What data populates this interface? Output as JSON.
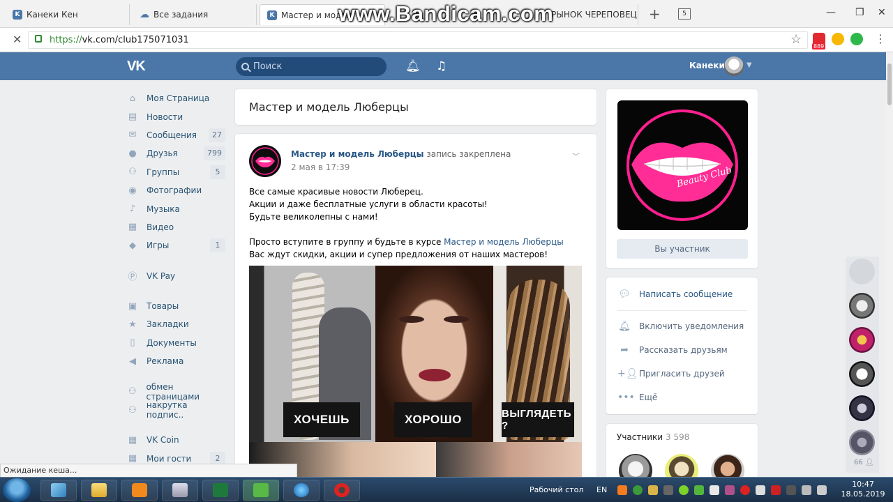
{
  "browser": {
    "tabs": [
      {
        "label": "Канеки Кен",
        "active": false
      },
      {
        "label": "Все задания",
        "active": false
      },
      {
        "label": "Мастер и модел",
        "active": true
      },
      {
        "label": "РЫНОК ЧЕРЕПОВЕЦ",
        "active": false
      }
    ],
    "tab_count": "5",
    "url_scheme": "https://",
    "url_rest": "vk.com/club175071031",
    "extension_badge": "889",
    "watermark": "www.Bandicam.com",
    "status_text": "Ожидание кеша..."
  },
  "header": {
    "logo": "VK",
    "search_placeholder": "Поиск",
    "user_name": "Канеки"
  },
  "nav": [
    {
      "label": "Моя Страница",
      "icon": "home-icon",
      "glyph": "⌂",
      "count": ""
    },
    {
      "label": "Новости",
      "icon": "news-icon",
      "glyph": "▤",
      "count": ""
    },
    {
      "label": "Сообщения",
      "icon": "messages-icon",
      "glyph": "✉",
      "count": "27"
    },
    {
      "label": "Друзья",
      "icon": "friends-icon",
      "glyph": "●",
      "count": "799"
    },
    {
      "label": "Группы",
      "icon": "groups-icon",
      "glyph": "⚇",
      "count": "5"
    },
    {
      "label": "Фотографии",
      "icon": "camera-icon",
      "glyph": "◉",
      "count": ""
    },
    {
      "label": "Музыка",
      "icon": "music-icon",
      "glyph": "♪",
      "count": ""
    },
    {
      "label": "Видео",
      "icon": "video-icon",
      "glyph": "▦",
      "count": ""
    },
    {
      "label": "Игры",
      "icon": "games-icon",
      "glyph": "◆",
      "count": "1"
    },
    {
      "sep": true
    },
    {
      "label": "VK Pay",
      "icon": "vkpay-icon",
      "glyph": "Ⓟ",
      "count": ""
    },
    {
      "sep": true
    },
    {
      "label": "Товары",
      "icon": "bag-icon",
      "glyph": "▣",
      "count": ""
    },
    {
      "label": "Закладки",
      "icon": "star-icon",
      "glyph": "★",
      "count": ""
    },
    {
      "label": "Документы",
      "icon": "document-icon",
      "glyph": "▯",
      "count": ""
    },
    {
      "label": "Реклама",
      "icon": "megaphone-icon",
      "glyph": "◀",
      "count": ""
    },
    {
      "sep": true
    },
    {
      "label": "обмен страницами",
      "icon": "community-icon",
      "glyph": "⚇",
      "count": ""
    },
    {
      "label": "накрутка подпис..",
      "icon": "community-icon",
      "glyph": "⚇",
      "count": ""
    },
    {
      "sep": true
    },
    {
      "label": "VK Coin",
      "icon": "apps-icon",
      "glyph": "▦",
      "count": ""
    },
    {
      "label": "Мои гости",
      "icon": "apps-icon",
      "glyph": "▦",
      "count": "2"
    }
  ],
  "group": {
    "title": "Мастер и модель Люберцы"
  },
  "post": {
    "author": "Мастер и модель Люберцы",
    "author_suffix": "запись закреплена",
    "date": "2 мая в 17:39",
    "line1": "Все самые красивые новости Люберец.",
    "line2": "Акции и даже бесплатные услуги в области красоты!",
    "line3": "Будьте великолепны с нами!",
    "line4_prefix": "Просто вступите в группу и будьте в курсе",
    "line4_link": "Мастер и модель Люберцы",
    "line5": "Вас ждут скидки, акции и супер предложения от наших мастеров!",
    "image_labels": [
      "ХОЧЕШЬ",
      "ХОРОШО",
      "ВЫГЛЯДЕТЬ ?"
    ]
  },
  "cover": {
    "logo_text": "Beauty Club",
    "member_button": "Вы участник"
  },
  "actions": {
    "write": "Написать сообщение",
    "notify": "Включить уведомления",
    "share": "Рассказать друзьям",
    "invite": "Пригласить друзей",
    "more": "Ещё"
  },
  "members": {
    "title": "Участники",
    "count": "3 598"
  },
  "quickbar": {
    "count": "66"
  },
  "taskbar": {
    "desktop_label": "Рабочий стол",
    "lang": "EN",
    "time": "10:47",
    "date": "18.05.2019"
  },
  "colors": {
    "vk_blue": "#4a76a8",
    "link": "#2a5885",
    "brand_pink": "#ff1f8f",
    "background": "#edeef0"
  }
}
